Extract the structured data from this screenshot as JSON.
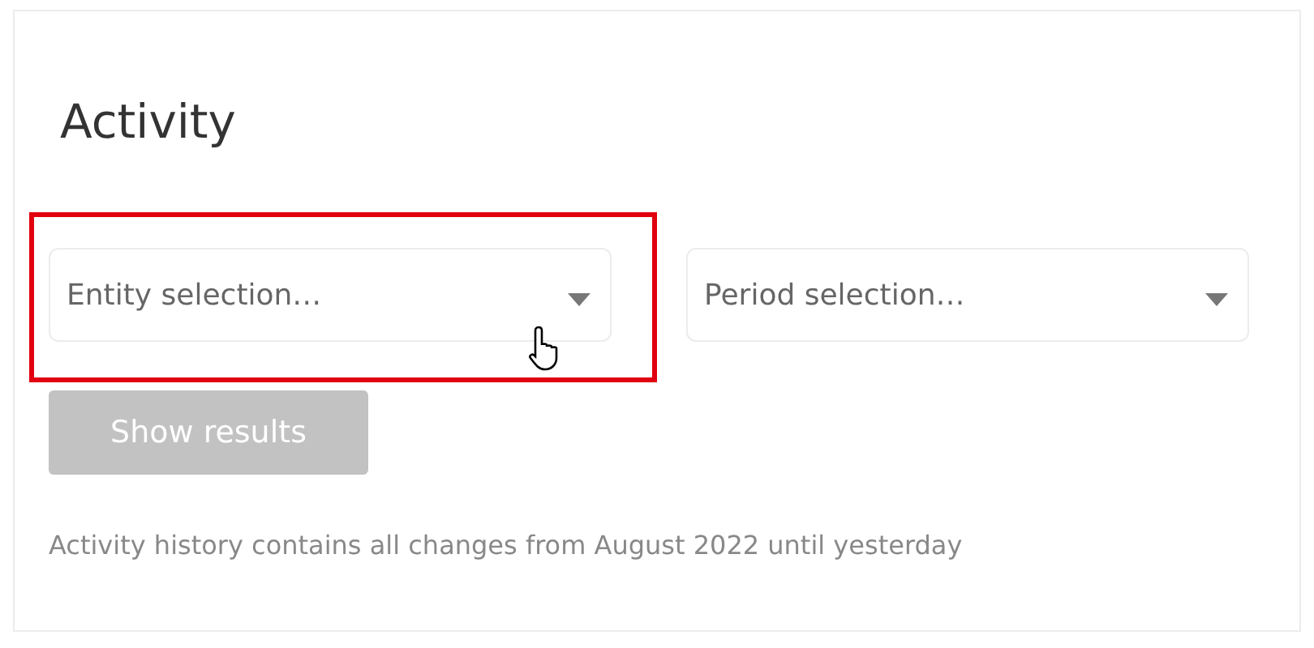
{
  "title": "Activity",
  "filters": [
    {
      "placeholder": "Entity selection…",
      "highlighted": true,
      "hovered": true
    },
    {
      "placeholder": "Period selection…",
      "highlighted": false,
      "hovered": false
    }
  ],
  "action": {
    "label": "Show results",
    "disabled": true
  },
  "note": "Activity history contains all changes from August 2022 until yesterday"
}
